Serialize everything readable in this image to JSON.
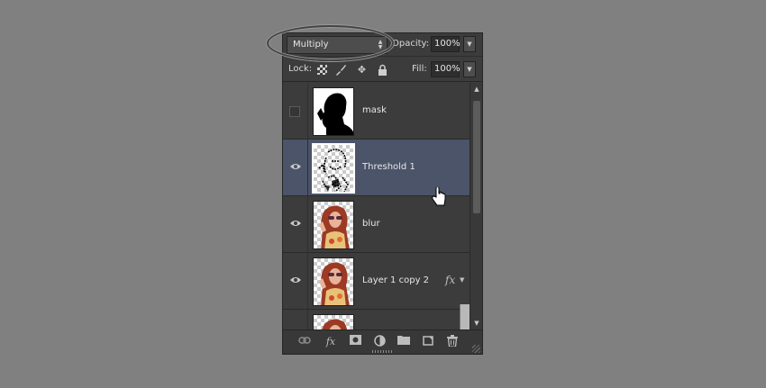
{
  "blend": {
    "mode": "Multiply"
  },
  "opacity": {
    "label": "Opacity:",
    "value": "100%"
  },
  "lock": {
    "label": "Lock:"
  },
  "fill": {
    "label": "Fill:",
    "value": "100%"
  },
  "layers": [
    {
      "name": "mask",
      "visible": false,
      "selected": false,
      "thumbnail": "silhouette-mask",
      "fx": false
    },
    {
      "name": "Threshold 1",
      "visible": true,
      "selected": true,
      "thumbnail": "threshold-portrait",
      "fx": false
    },
    {
      "name": "blur",
      "visible": true,
      "selected": false,
      "thumbnail": "color-portrait",
      "fx": false
    },
    {
      "name": "Layer 1 copy 2",
      "visible": true,
      "selected": false,
      "thumbnail": "color-portrait",
      "fx": true,
      "fx_label": "fx"
    },
    {
      "name": "",
      "visible": false,
      "selected": false,
      "thumbnail": "color-portrait",
      "fx": false
    }
  ],
  "bottom_icons": [
    "link-icon",
    "fx-icon",
    "mask-icon",
    "adjustment-icon",
    "folder-icon",
    "new-layer-icon",
    "trash-icon"
  ],
  "colors": {
    "panel": "#3c3c3c",
    "selected": "#4b5468",
    "background": "#808080"
  }
}
